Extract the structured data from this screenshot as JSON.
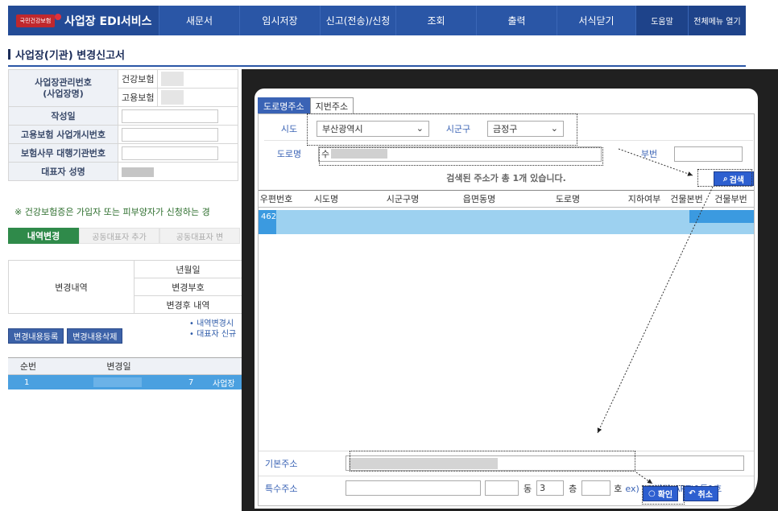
{
  "header": {
    "logo_text": "국민건강보험",
    "title": "사업장 EDI서비스",
    "menu": [
      "새문서",
      "임시저장",
      "신고(전송)/신청",
      "조회",
      "출력",
      "서식닫기"
    ],
    "help": "도움말",
    "all_menu": "전체메뉴 열기"
  },
  "page_title": "사업장(기관) 변경신고서",
  "form": {
    "mgmt_no_label": "사업장관리번호\n(사업장명)",
    "health_insurance": "건강보험",
    "employment_insurance": "고용보험",
    "write_date": "작성일",
    "emp_start_no": "고용보험 사업개시번호",
    "agency_no": "보험사무 대행기관번호",
    "representative": "대표자 성명"
  },
  "notice": "※ 건강보험증은 가입자 또는 피부양자가 신청하는 경",
  "tabs": [
    "내역변경",
    "공동대표자 추가",
    "공동대표자 변"
  ],
  "change": {
    "label": "변경내역",
    "rows": [
      "년월일",
      "변경부호",
      "변경후 내역"
    ]
  },
  "buttons": {
    "register": "변경내용등록",
    "delete": "변경내용삭제"
  },
  "hints": [
    "• 내역변경시",
    "• 대표자 신규"
  ],
  "grid": {
    "col_seq": "순번",
    "col_date": "변경일",
    "row_seq": "1",
    "row_code": "7",
    "row_text": "사업장"
  },
  "dialog": {
    "tab_road": "도로명주소",
    "tab_lot": "지번주소",
    "sido_label": "시도",
    "sido_value": "부산광역시",
    "sigungu_label": "시군구",
    "sigungu_value": "금정구",
    "road_label": "도로명",
    "road_value": "수",
    "bunji_label": "부번",
    "found_text": "검색된 주소가  총 1개  있습니다.",
    "search_btn": "검색",
    "columns": [
      "우편번호",
      "시도명",
      "시군구명",
      "읍면동명",
      "도로명",
      "지하여부",
      "건물본번",
      "건물부번"
    ],
    "row_zip": "462",
    "basic_label": "기본주소",
    "special_label": "특수주소",
    "dong": "동",
    "floor_value": "3",
    "floor": "층",
    "ho": "호",
    "example": "ex) XX빌딩(APT)1동1호",
    "ok": "확인",
    "cancel": "취소"
  },
  "colors": {
    "nav": "#2a56a6",
    "accent": "#2d5fd0",
    "selected_row": "#3b9ae0",
    "green_tab": "#2f8a4a"
  }
}
